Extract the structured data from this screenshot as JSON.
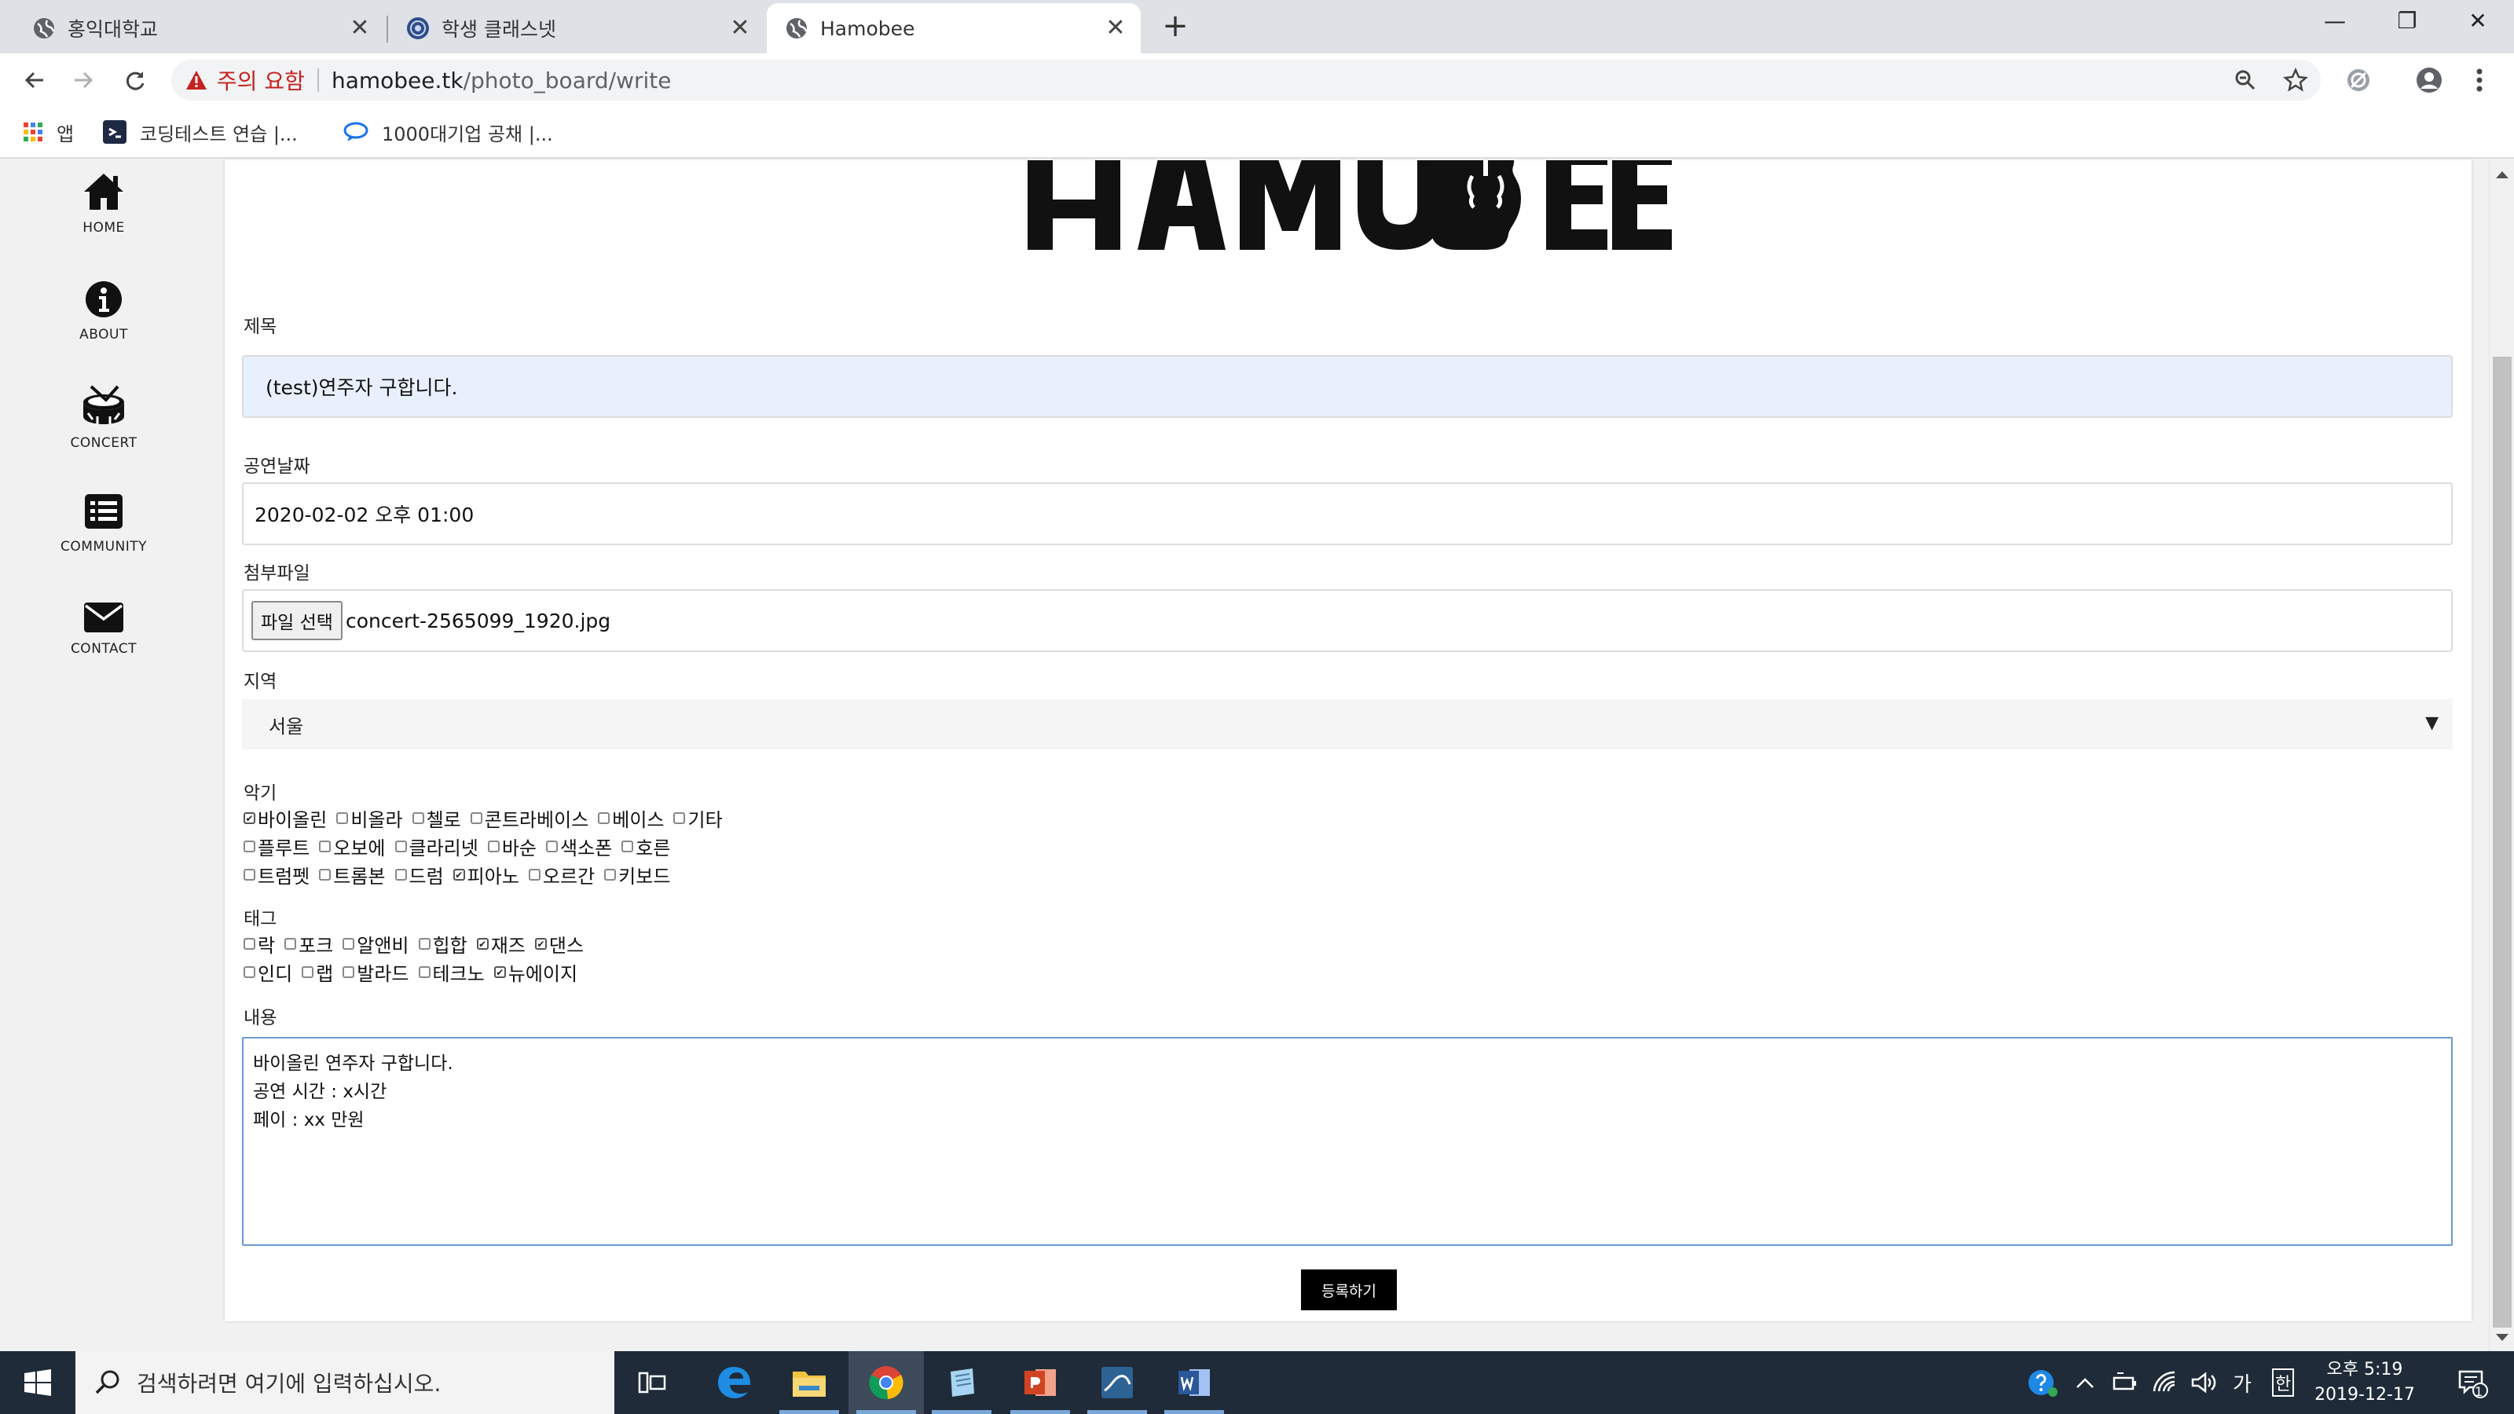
{
  "browser": {
    "tabs": [
      {
        "title": "홍익대학교",
        "active": false
      },
      {
        "title": "학생 클래스넷",
        "active": false
      },
      {
        "title": "Hamobee",
        "active": true
      }
    ],
    "security_warning": "주의 요함",
    "url_host": "hamobee.tk",
    "url_path": "/photo_board/write",
    "bookmarks": [
      {
        "label": "앱"
      },
      {
        "label": "코딩테스트 연습 |..."
      },
      {
        "label": "1000대기업 공채 |..."
      }
    ]
  },
  "sidebar": {
    "items": [
      {
        "label": "HOME",
        "icon": "home-icon"
      },
      {
        "label": "ABOUT",
        "icon": "info-icon"
      },
      {
        "label": "CONCERT",
        "icon": "drum-icon"
      },
      {
        "label": "COMMUNITY",
        "icon": "list-icon"
      },
      {
        "label": "CONTACT",
        "icon": "envelope-icon"
      }
    ]
  },
  "form": {
    "logo_text": "HAMOBEE",
    "title_label": "제목",
    "title_value": "(test)연주자 구합니다.",
    "date_label": "공연날짜",
    "date_value": "2020-02-02 오후 01:00",
    "file_label": "첨부파일",
    "file_button": "파일 선택",
    "file_name": "concert-2565099_1920.jpg",
    "region_label": "지역",
    "region_value": "서울",
    "instrument_label": "악기",
    "instruments": [
      [
        {
          "label": "바이올린",
          "checked": true
        },
        {
          "label": "비올라",
          "checked": false
        },
        {
          "label": "첼로",
          "checked": false
        },
        {
          "label": "콘트라베이스",
          "checked": false
        },
        {
          "label": "베이스",
          "checked": false
        },
        {
          "label": "기타",
          "checked": false
        }
      ],
      [
        {
          "label": "플루트",
          "checked": false
        },
        {
          "label": "오보에",
          "checked": false
        },
        {
          "label": "클라리넷",
          "checked": false
        },
        {
          "label": "바순",
          "checked": false
        },
        {
          "label": "색소폰",
          "checked": false
        },
        {
          "label": "호른",
          "checked": false
        }
      ],
      [
        {
          "label": "트럼펫",
          "checked": false
        },
        {
          "label": "트롬본",
          "checked": false
        },
        {
          "label": "드럼",
          "checked": false
        },
        {
          "label": "피아노",
          "checked": true
        },
        {
          "label": "오르간",
          "checked": false
        },
        {
          "label": "키보드",
          "checked": false
        }
      ]
    ],
    "tag_label": "태그",
    "tags": [
      [
        {
          "label": "락",
          "checked": false
        },
        {
          "label": "포크",
          "checked": false
        },
        {
          "label": "알앤비",
          "checked": false
        },
        {
          "label": "힙합",
          "checked": false
        },
        {
          "label": "재즈",
          "checked": true
        },
        {
          "label": "댄스",
          "checked": true
        }
      ],
      [
        {
          "label": "인디",
          "checked": false
        },
        {
          "label": "랩",
          "checked": false
        },
        {
          "label": "발라드",
          "checked": false
        },
        {
          "label": "테크노",
          "checked": false
        },
        {
          "label": "뉴에이지",
          "checked": true
        }
      ]
    ],
    "content_label": "내용",
    "content_lines": [
      "바이올린 연주자 구합니다.",
      "공연 시간 : x시간",
      "페이 : xx 만원"
    ],
    "submit_label": "등록하기"
  },
  "taskbar": {
    "search_placeholder": "검색하려면 여기에 입력하십시오.",
    "ime": "가",
    "ime_mode": "한",
    "time": "오후 5:19",
    "date": "2019-12-17",
    "notification_count": "1"
  }
}
